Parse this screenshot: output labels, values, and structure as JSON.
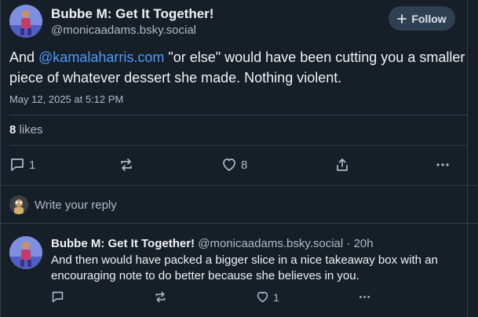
{
  "post": {
    "author_name": "Bubbe M: Get It Together!",
    "author_handle": "@monicaadams.bsky.social",
    "follow_label": "Follow",
    "text_before": "And ",
    "mention": "@kamalaharris.com",
    "text_after": " \"or else\" would have been cutting you a smaller piece of whatever dessert she made. Nothing violent.",
    "timestamp": "May 12, 2025 at 5:12 PM",
    "likes_count": "8",
    "likes_label": "likes",
    "reply_count": "1",
    "like_count": "8"
  },
  "compose": {
    "placeholder": "Write your reply"
  },
  "reply": {
    "author_name": "Bubbe M: Get It Together!",
    "author_handle": "@monicaadams.bsky.social",
    "separator": "·",
    "age": "20h",
    "text": "And then would have packed a bigger slice in a nice takeaway box with an encouraging note to do better because she believes in you.",
    "like_count": "1"
  },
  "colors": {
    "background": "#161e27",
    "divider": "#2e4052",
    "link": "#4c9cff",
    "muted": "#aebbc9"
  }
}
